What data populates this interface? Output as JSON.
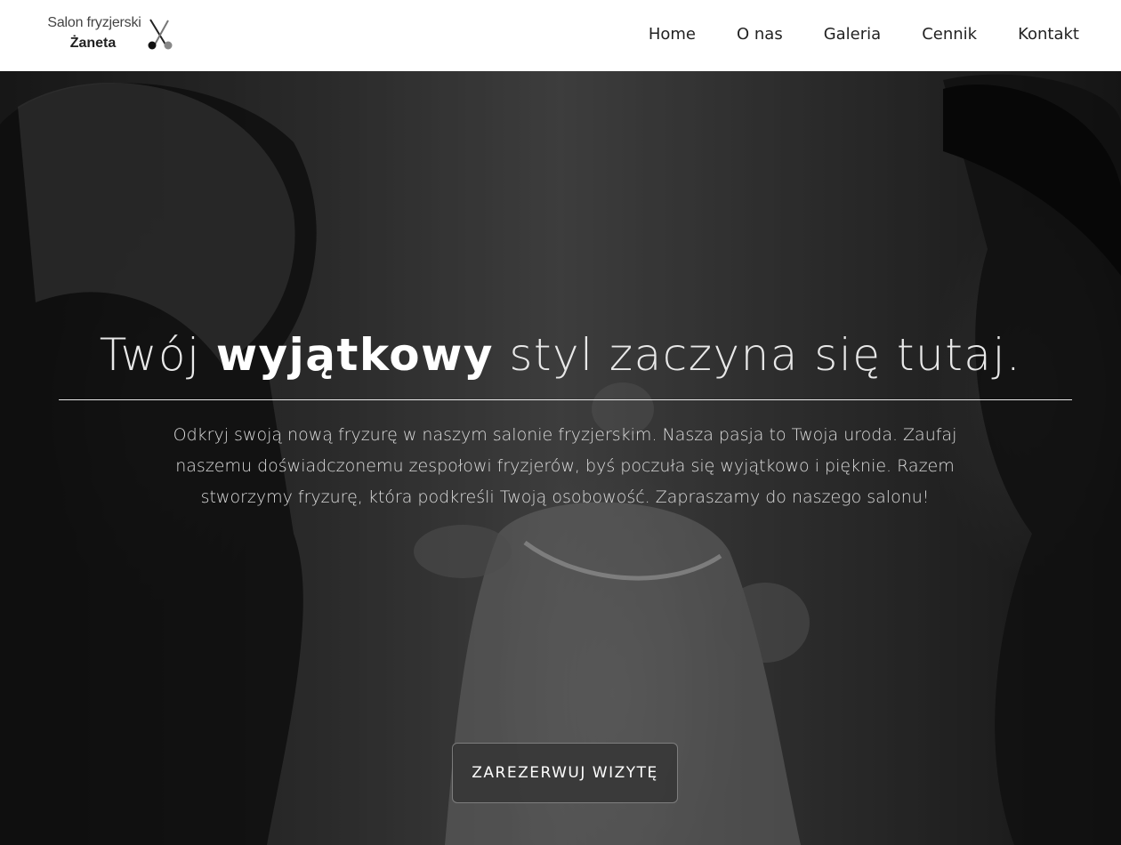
{
  "brand": {
    "line1": "Salon fryzjerski",
    "line2": "Żaneta",
    "icon": "scissors-icon"
  },
  "nav": {
    "items": [
      {
        "label": "Home"
      },
      {
        "label": "O nas"
      },
      {
        "label": "Galeria"
      },
      {
        "label": "Cennik"
      },
      {
        "label": "Kontakt"
      }
    ]
  },
  "hero": {
    "title_before": "Twój",
    "title_emphasis": "wyjątkowy",
    "title_after": "styl zaczyna się tutaj.",
    "description": "Odkryj swoją nową fryzurę w naszym salonie fryzjerskim. Nasza pasja to Twoja uroda. Zaufaj naszemu doświadczonemu zespołowi fryzjerów, byś poczuła się wyjątkowo i pięknie. Razem stworzymy fryzurę, która podkreśli Twoją osobowość. Zapraszamy do naszego salonu!",
    "cta_label": "ZAREZERWUJ WIZYTĘ"
  },
  "colors": {
    "header_bg": "#ffffff",
    "nav_text": "#222222",
    "hero_text": "#ffffff"
  }
}
